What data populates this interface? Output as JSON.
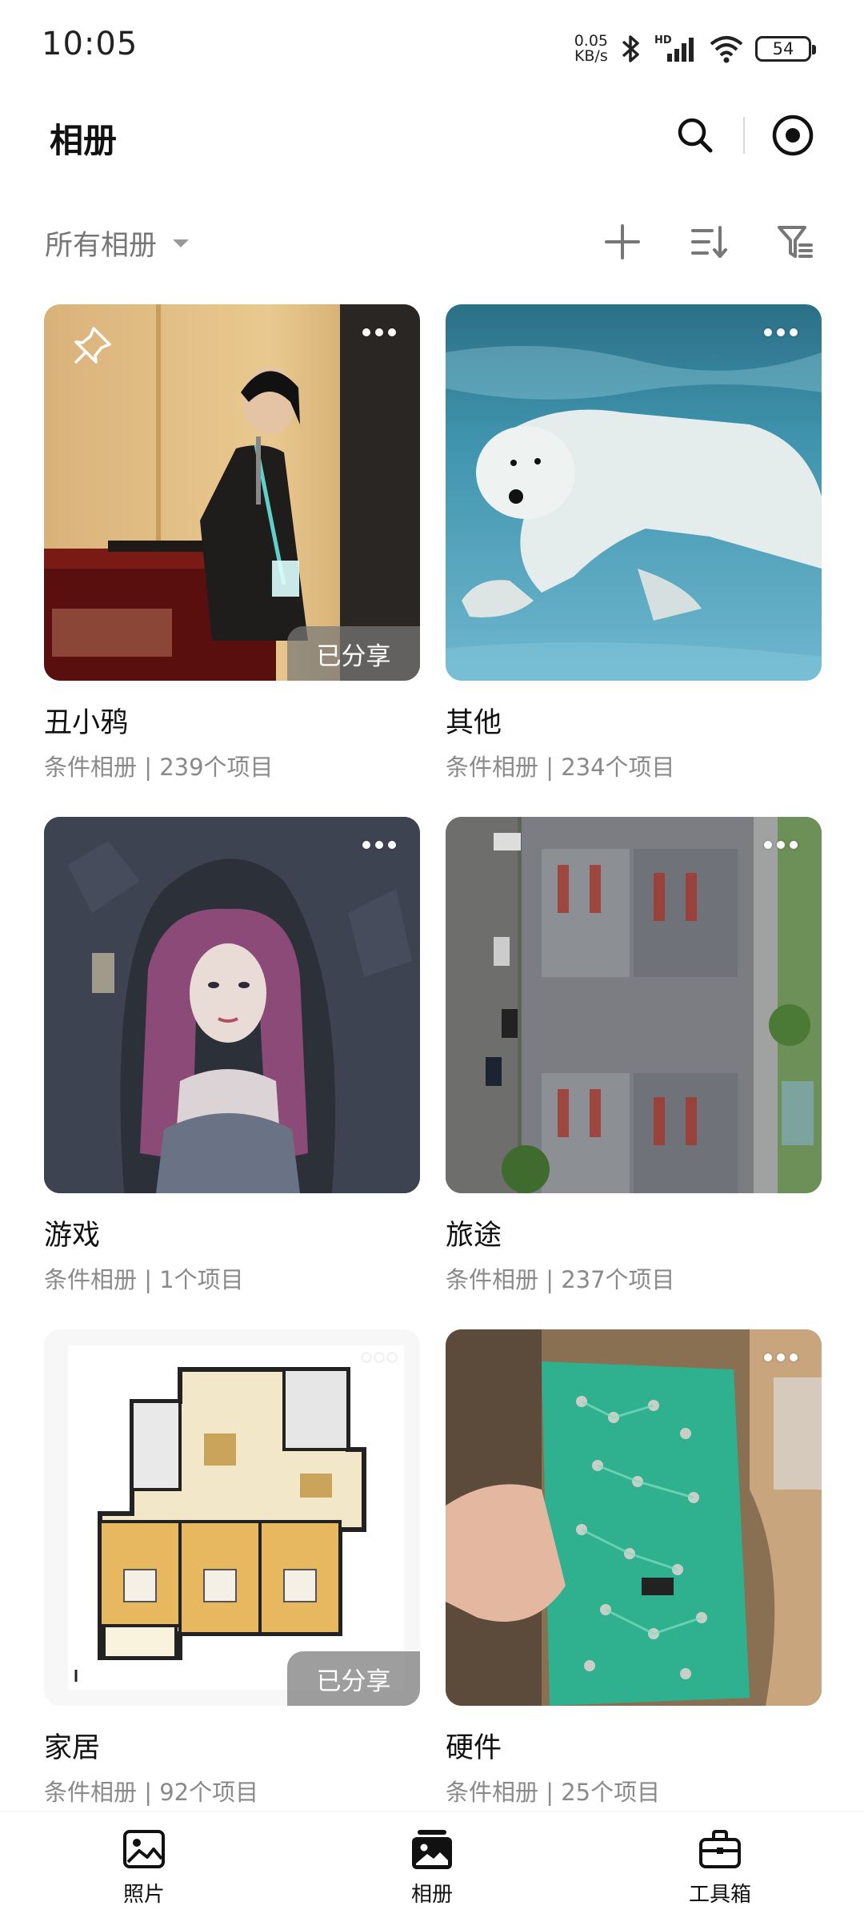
{
  "status_bar": {
    "time": "10:05",
    "net_speed_value": "0.05",
    "net_speed_unit": "KB/s",
    "signal_label": "HD",
    "battery": "54",
    "icons": [
      "bluetooth-icon",
      "cellular-signal-icon",
      "wifi-icon",
      "battery-icon"
    ]
  },
  "header": {
    "title": "相册",
    "actions": [
      "search-icon",
      "record-target-icon"
    ]
  },
  "filter_bar": {
    "selected": "所有相册",
    "actions": [
      "add-icon",
      "sort-icon",
      "filter-icon"
    ]
  },
  "albums": [
    {
      "name": "丑小鸦",
      "meta": "条件相册 | 239个项目",
      "pinned": true,
      "shared": "已分享"
    },
    {
      "name": "其他",
      "meta": "条件相册 | 234个项目",
      "pinned": false,
      "shared": ""
    },
    {
      "name": "游戏",
      "meta": "条件相册 | 1个项目",
      "pinned": false,
      "shared": ""
    },
    {
      "name": "旅途",
      "meta": "条件相册 | 237个项目",
      "pinned": false,
      "shared": ""
    },
    {
      "name": "家居",
      "meta": "条件相册 | 92个项目",
      "pinned": false,
      "shared": "已分享"
    },
    {
      "name": "硬件",
      "meta": "条件相册 | 25个项目",
      "pinned": false,
      "shared": ""
    }
  ],
  "bottom_nav": {
    "items": [
      {
        "label": "照片",
        "icon": "photos-icon"
      },
      {
        "label": "相册",
        "icon": "albums-icon",
        "active": true
      },
      {
        "label": "工具箱",
        "icon": "toolbox-icon"
      }
    ]
  },
  "colors": {
    "primary_text": "#111111",
    "secondary_text": "#8a8a8a",
    "filter_text": "#777777",
    "shared_tag_bg": "#787878"
  }
}
